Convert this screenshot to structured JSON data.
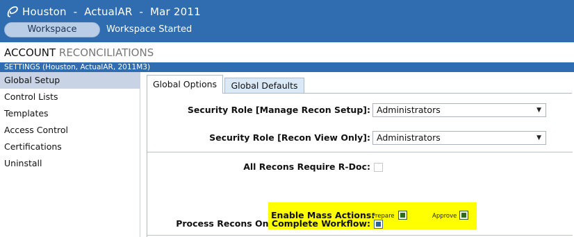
{
  "header": {
    "title": "Houston  -  ActualAR  -  Mar 2011",
    "workspace_button": "Workspace",
    "workspace_status": "Workspace Started"
  },
  "page": {
    "title_main": "ACCOUNT",
    "title_sub": "RECONCILIATIONS"
  },
  "settings_bar": {
    "text": "SETTINGS  (Houston, ActualAR, 2011M3)"
  },
  "sidebar": {
    "items": [
      {
        "label": "Global Setup",
        "active": true
      },
      {
        "label": "Control Lists",
        "active": false
      },
      {
        "label": "Templates",
        "active": false
      },
      {
        "label": "Access Control",
        "active": false
      },
      {
        "label": "Certifications",
        "active": false
      },
      {
        "label": "Uninstall",
        "active": false
      }
    ]
  },
  "tabs": [
    {
      "label": "Global Options",
      "active": true
    },
    {
      "label": "Global Defaults",
      "active": false
    }
  ],
  "form": {
    "security_manage_label": "Security Role [Manage Recon Setup]:",
    "security_manage_value": "Administrators",
    "security_view_label": "Security Role [Recon View Only]:",
    "security_view_value": "Administrators",
    "all_recons_label": "All Recons Require R-Doc:",
    "all_recons_checked": false,
    "mass_actions_label": "Enable Mass Actions:",
    "prepare_label": "Prepare",
    "prepare_checked": true,
    "approve_label": "Approve",
    "approve_checked": true,
    "process_label": "Process Recons On Complete Workflow:",
    "process_checked": true
  },
  "colors": {
    "header_blue": "#2f6db0",
    "highlight_yellow": "#ffff00",
    "sidebar_active": "#c8d3e6",
    "tab_inactive": "#dbe8f6"
  },
  "icons": {
    "app_logo": "app-logo-icon",
    "dropdown_arrow": "dropdown-arrow-icon"
  }
}
